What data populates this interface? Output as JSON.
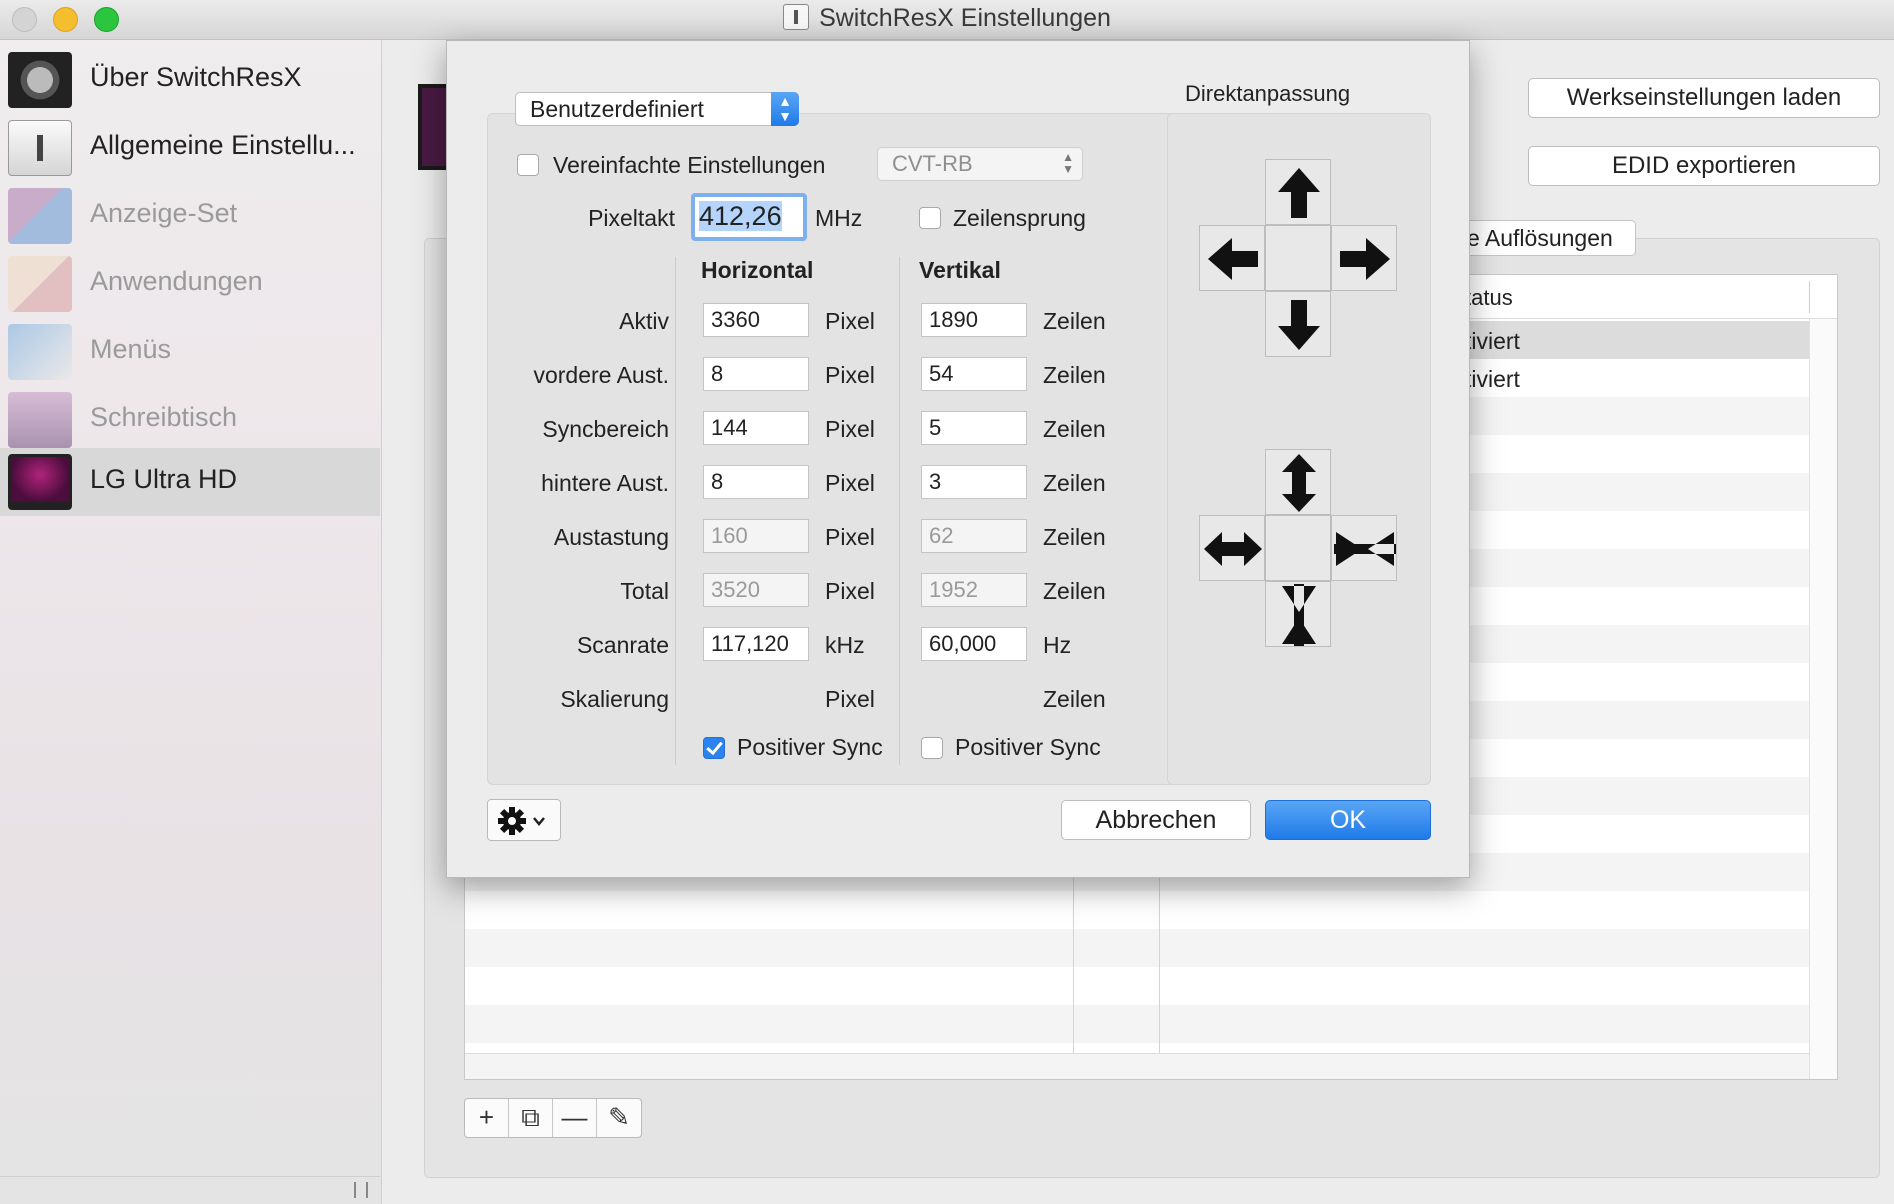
{
  "window": {
    "title": "SwitchResX Einstellungen"
  },
  "sidebar": {
    "items": [
      {
        "label": "Über SwitchResX",
        "icon": "gear-display-icon"
      },
      {
        "label": "Allgemeine Einstellu...",
        "icon": "switch-icon"
      },
      {
        "label": "Anzeige-Set",
        "icon": "displays-icon"
      },
      {
        "label": "Anwendungen",
        "icon": "applications-icon"
      },
      {
        "label": "Menüs",
        "icon": "menus-icon"
      },
      {
        "label": "Schreibtisch",
        "icon": "desktop-icon"
      },
      {
        "label": "LG Ultra HD",
        "icon": "monitor-icon"
      }
    ],
    "selected": "LG Ultra HD"
  },
  "main": {
    "buttons": {
      "factory": "Werkseinstellungen laden",
      "edid": "EDID exportieren"
    },
    "tab": "e Auflösungen",
    "table": {
      "status_header": "tatus",
      "rows": [
        "tiviert",
        "tiviert"
      ]
    },
    "toolbar": {
      "add": "+",
      "duplicate": "⧉",
      "remove": "—",
      "edit": "✎"
    }
  },
  "dialog": {
    "preset": "Benutzerdefiniert",
    "simplified_label": "Vereinfachte Einstellungen",
    "simplified_checked": false,
    "timing_select": "CVT-RB",
    "pixelclock_label": "Pixeltakt",
    "pixelclock_value": "412,26",
    "pixelclock_unit": "MHz",
    "interlace_label": "Zeilensprung",
    "interlace_checked": false,
    "horizontal_header": "Horizontal",
    "vertical_header": "Vertikal",
    "rows": [
      {
        "label": "Aktiv",
        "h": "3360",
        "h_unit": "Pixel",
        "v": "1890",
        "v_unit": "Zeilen",
        "readonly": false
      },
      {
        "label": "vordere Aust.",
        "h": "8",
        "h_unit": "Pixel",
        "v": "54",
        "v_unit": "Zeilen",
        "readonly": false
      },
      {
        "label": "Syncbereich",
        "h": "144",
        "h_unit": "Pixel",
        "v": "5",
        "v_unit": "Zeilen",
        "readonly": false
      },
      {
        "label": "hintere Aust.",
        "h": "8",
        "h_unit": "Pixel",
        "v": "3",
        "v_unit": "Zeilen",
        "readonly": false
      },
      {
        "label": "Austastung",
        "h": "160",
        "h_unit": "Pixel",
        "v": "62",
        "v_unit": "Zeilen",
        "readonly": true
      },
      {
        "label": "Total",
        "h": "3520",
        "h_unit": "Pixel",
        "v": "1952",
        "v_unit": "Zeilen",
        "readonly": true
      },
      {
        "label": "Scanrate",
        "h": "117,120",
        "h_unit": "kHz",
        "v": "60,000",
        "v_unit": "Hz",
        "readonly": false
      },
      {
        "label": "Skalierung",
        "h": "",
        "h_unit": "Pixel",
        "v": "",
        "v_unit": "Zeilen",
        "readonly": false
      }
    ],
    "h_sync_label": "Positiver Sync",
    "h_sync_checked": true,
    "v_sync_label": "Positiver Sync",
    "v_sync_checked": false,
    "direct_title": "Direktanpassung",
    "cancel": "Abbrechen",
    "ok": "OK",
    "accent": "#2d83ee"
  }
}
